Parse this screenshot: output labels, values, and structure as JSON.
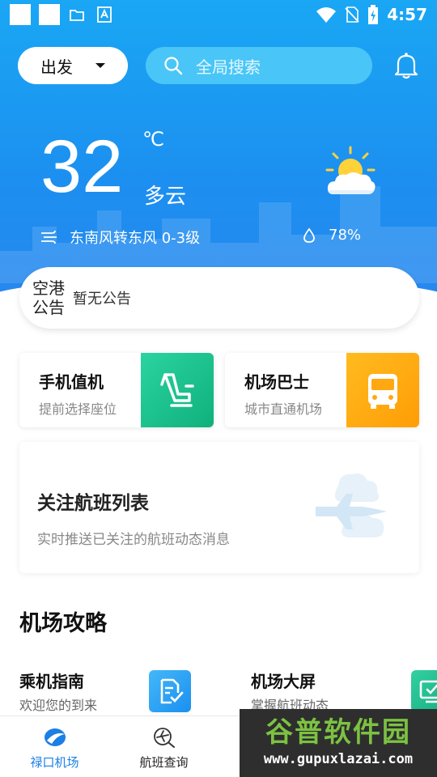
{
  "status_bar": {
    "time": "4:57",
    "icons": [
      "notification-square-icon",
      "notification-square-icon",
      "folder-icon",
      "text-a-icon",
      "wifi-icon",
      "no-sim-icon",
      "battery-charging-icon"
    ]
  },
  "header": {
    "direction_label": "出发",
    "search_placeholder": "全局搜索",
    "icons": [
      "chevron-down-icon",
      "search-icon",
      "bell-icon"
    ]
  },
  "weather": {
    "temperature": "32",
    "unit": "℃",
    "condition": "多云",
    "wind": "东南风转东风 0-3级",
    "humidity": "78%",
    "icons": [
      "partly-cloudy-icon",
      "wind-icon",
      "humidity-drop-icon"
    ]
  },
  "notice": {
    "label": "空港\n公告",
    "text": "暂无公告"
  },
  "services": [
    {
      "title": "手机值机",
      "subtitle": "提前选择座位",
      "icon": "seat-icon",
      "color": "#19c28f"
    },
    {
      "title": "机场巴士",
      "subtitle": "城市直通机场",
      "icon": "bus-icon",
      "color": "#ffa812"
    }
  ],
  "follow_flights": {
    "title": "关注航班列表",
    "subtitle": "实时推送已关注的航班动态消息",
    "icon": "plane-clouds-icon"
  },
  "guide_section": {
    "title": "机场攻略",
    "items": [
      {
        "title": "乘机指南",
        "subtitle": "欢迎您的到来",
        "icon": "document-check-icon",
        "color": "#2a9cf0"
      },
      {
        "title": "机场大屏",
        "subtitle": "掌握航班动态",
        "icon": "monitor-check-icon",
        "color": "#1fb98a"
      }
    ]
  },
  "tabs": [
    {
      "label": "禄口机场",
      "icon": "airport-logo-icon",
      "active": true
    },
    {
      "label": "航班查询",
      "icon": "plane-search-icon",
      "active": false
    }
  ],
  "watermark": {
    "title": "谷普软件园",
    "url": "www.gupuxlazai.com"
  },
  "colors": {
    "primary": "#1b8ff0",
    "active_tab": "#1b7fe6",
    "checkin_tile": "#19c28f",
    "bus_tile": "#ffa812"
  }
}
